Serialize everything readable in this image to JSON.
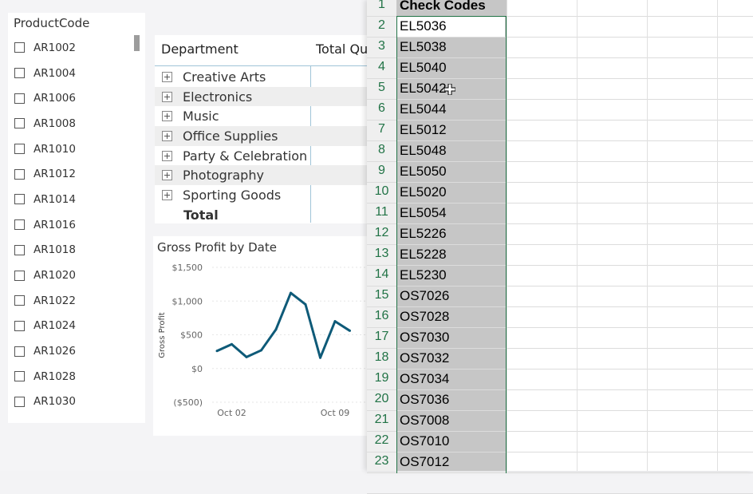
{
  "slicer": {
    "title": "ProductCode",
    "items": [
      "AR1002",
      "AR1004",
      "AR1006",
      "AR1008",
      "AR1010",
      "AR1012",
      "AR1014",
      "AR1016",
      "AR1018",
      "AR1020",
      "AR1022",
      "AR1024",
      "AR1026",
      "AR1028",
      "AR1030"
    ]
  },
  "matrix": {
    "col1": "Department",
    "col2": "Total Qu",
    "rows": [
      "Creative Arts",
      "Electronics",
      "Music",
      "Office Supplies",
      "Party & Celebration",
      "Photography",
      "Sporting Goods"
    ],
    "total_label": "Total"
  },
  "chart": {
    "title": "Gross Profit by Date",
    "ylabel": "Gross Profit",
    "ytick_labels": [
      "$1,500",
      "$1,000",
      "$500",
      "$0",
      "($500)"
    ],
    "xtick_labels": [
      "Oct 02",
      "Oct 09"
    ]
  },
  "chart_data": {
    "type": "line",
    "title": "Gross Profit by Date",
    "ylabel": "Gross Profit",
    "xlabel": "",
    "ylim": [
      -500,
      1500
    ],
    "x": [
      1,
      2,
      3,
      4,
      5,
      6,
      7,
      8,
      9,
      10
    ],
    "values": [
      260,
      360,
      170,
      270,
      580,
      1120,
      950,
      160,
      700,
      560
    ],
    "x_ticks": [
      {
        "x": 2,
        "label": "Oct 02"
      },
      {
        "x": 9,
        "label": "Oct 09"
      }
    ],
    "y_ticks": [
      1500,
      1000,
      500,
      0,
      -500
    ],
    "line_color": "#0e5a78"
  },
  "excel": {
    "rows": [
      {
        "n": "1",
        "v": "Check Codes"
      },
      {
        "n": "2",
        "v": "EL5036"
      },
      {
        "n": "3",
        "v": "EL5038"
      },
      {
        "n": "4",
        "v": "EL5040"
      },
      {
        "n": "5",
        "v": "EL5042"
      },
      {
        "n": "6",
        "v": "EL5044"
      },
      {
        "n": "7",
        "v": "EL5012"
      },
      {
        "n": "8",
        "v": "EL5048"
      },
      {
        "n": "9",
        "v": "EL5050"
      },
      {
        "n": "10",
        "v": "EL5020"
      },
      {
        "n": "11",
        "v": "EL5054"
      },
      {
        "n": "12",
        "v": "EL5226"
      },
      {
        "n": "13",
        "v": "EL5228"
      },
      {
        "n": "14",
        "v": "EL5230"
      },
      {
        "n": "15",
        "v": "OS7026"
      },
      {
        "n": "16",
        "v": "OS7028"
      },
      {
        "n": "17",
        "v": "OS7030"
      },
      {
        "n": "18",
        "v": "OS7032"
      },
      {
        "n": "19",
        "v": "OS7034"
      },
      {
        "n": "20",
        "v": "OS7036"
      },
      {
        "n": "21",
        "v": "OS7008"
      },
      {
        "n": "22",
        "v": "OS7010"
      },
      {
        "n": "23",
        "v": "OS7012"
      }
    ],
    "accent": "#217346"
  }
}
